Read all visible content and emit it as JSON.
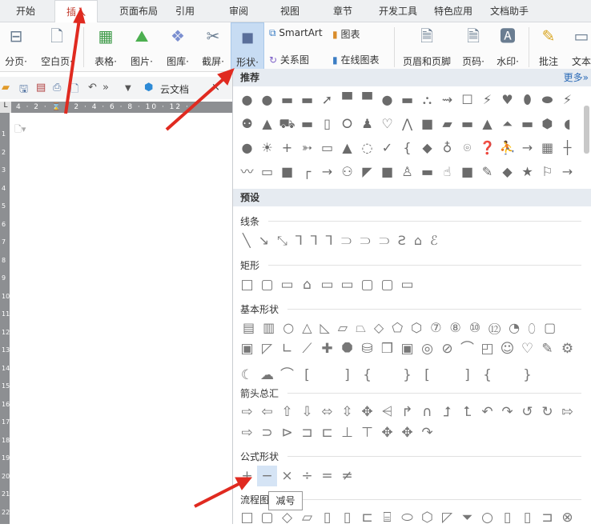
{
  "tabs": [
    "开始",
    "插入",
    "页面布局",
    "引用",
    "审阅",
    "视图",
    "章节",
    "开发工具",
    "特色应用",
    "文档助手"
  ],
  "active_tab": "插入",
  "ribbon": {
    "page_break": "分页·",
    "blank_page": "空白页·",
    "table": "表格·",
    "picture": "图片·",
    "gallery": "图库·",
    "screenshot": "截屏·",
    "shapes": "形状·",
    "smartart": "SmartArt",
    "chart": "图表",
    "relation": "关系图",
    "online_chart": "在线图表",
    "header_footer": "页眉和页脚",
    "page_number": "页码·",
    "watermark": "水印·",
    "comment": "批注",
    "textbox": "文本"
  },
  "quickbar": {
    "cloud_doc": "云文档",
    "close": "×"
  },
  "ruler": {
    "h": "4 · 2 · ⌛ · 2 · 4 · 6 · 8 · 10 · 12 ·",
    "v": [
      "1",
      "2",
      "3",
      "4",
      "5",
      "6",
      "7",
      "8",
      "9",
      "10",
      "11",
      "12",
      "13",
      "14",
      "15",
      "16",
      "17",
      "18",
      "19",
      "20",
      "21",
      "22"
    ]
  },
  "panel": {
    "recommend": "推荐",
    "more": "更多»",
    "preset": "预设",
    "sections": {
      "lines": "线条",
      "rect": "矩形",
      "basic": "基本形状",
      "arrows": "箭头总汇",
      "equation": "公式形状",
      "flowchart": "流程图"
    },
    "tooltip": "减号"
  },
  "glyph_rows": {
    "rec1": "●●▬▬➚▀▀●▬⛬⇝☐⚡♥⬮⬬⚡",
    "rec2": "⚉▲⛟▬▯⭘♟♡⋀■▰▬▲⏶▬⬢◖",
    "rec3": "●☀+➳▭▲◌✓{◆♁⌾❓⛹→▦┼",
    "rec4": "〰▭■┌→⚇◤■♙▬☝■✎◆★⚐→",
    "lines": "╲↘⤡⅂⅂⅂⸧⸧⸧Ƨ⌂ℰ",
    "rect": "□▢▭⌂▭▭▢▢▭",
    "basic1": "▤▥○△◺▱⏢◇⬠⬡⑦⑧⑩⑫◔⬯▢",
    "basic2": "▣◸∟⟋✚⯃⛁❒▣◎⊘⌒◰☺♡✎⚙",
    "basic3": "☾☁⌒[ ]{ }[ ]{ }",
    "arrows1": "⇨⇦⇧⇩⬄⇳✥⩤↱∩⮥⮤↶↷↺↻⇰",
    "arrows2": "⇨⊃⊳⊐⊏⊥⊤✥✥↷",
    "equation": "+−×÷=≠",
    "flow": "□▢◇▱▯▯⊏⌸⬭⬡◸⏷○▯▯⊐⊗"
  },
  "colors": {
    "accent": "#c0392b",
    "selected": "#c7dcf3",
    "arrow": "#e02a20"
  }
}
